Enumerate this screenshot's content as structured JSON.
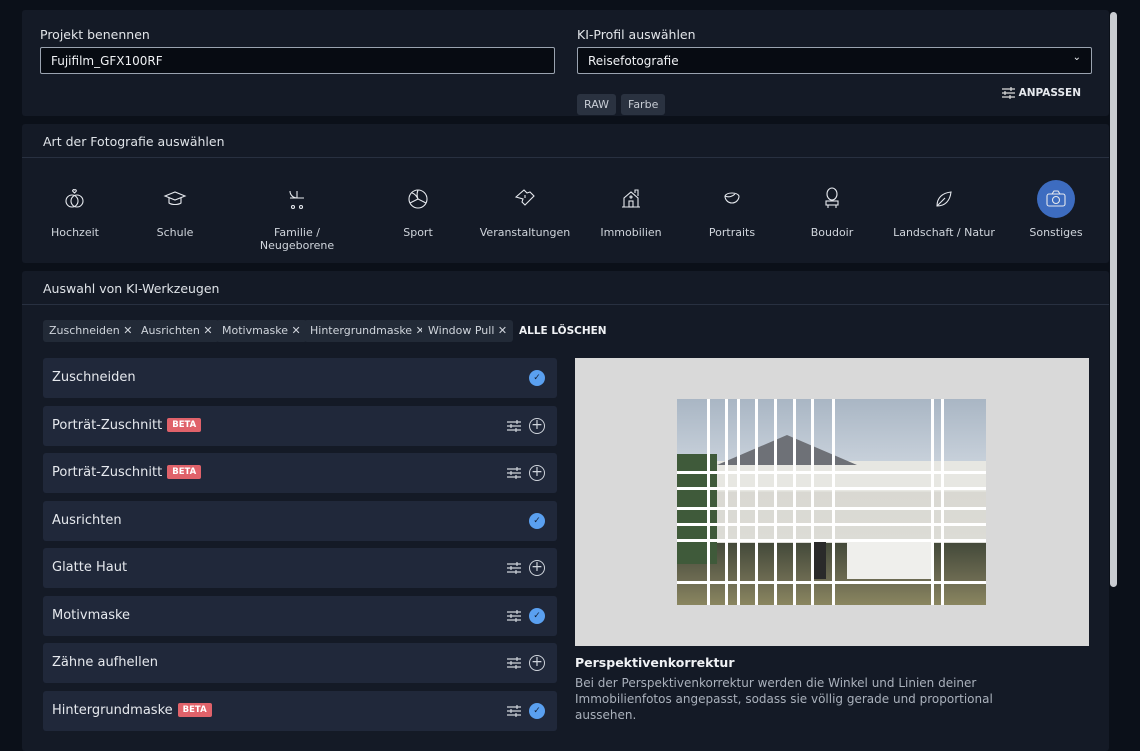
{
  "project": {
    "label": "Projekt benennen",
    "value": "Fujifilm_GFX100RF"
  },
  "profile": {
    "label": "KI-Profil auswählen",
    "value": "Reisefotografie",
    "chips": [
      "RAW",
      "Farbe"
    ],
    "adjust": "ANPASSEN"
  },
  "photo_types": {
    "title": "Art der Fotografie auswählen",
    "items": [
      {
        "label": "Hochzeit",
        "icon": "rings-icon"
      },
      {
        "label": "Schule",
        "icon": "graduation-cap-icon"
      },
      {
        "label": "Familie / Neugeborene",
        "icon": "stroller-icon"
      },
      {
        "label": "Sport",
        "icon": "volleyball-icon"
      },
      {
        "label": "Veranstaltungen",
        "icon": "ticket-icon"
      },
      {
        "label": "Immobilien",
        "icon": "house-icon"
      },
      {
        "label": "Portraits",
        "icon": "face-icon"
      },
      {
        "label": "Boudoir",
        "icon": "mirror-icon"
      },
      {
        "label": "Landschaft / Natur",
        "icon": "leaf-icon"
      },
      {
        "label": "Sonstiges",
        "icon": "camera-icon"
      }
    ],
    "selected": "Sonstiges"
  },
  "tools": {
    "title": "Auswahl von KI-Werkzeugen",
    "tags": [
      "Zuschneiden",
      "Ausrichten",
      "Motivmaske",
      "Hintergrundmaske",
      "Window Pull"
    ],
    "clear_all": "ALLE LÖSCHEN",
    "beta_label": "BETA",
    "items": [
      {
        "label": "Zuschneiden",
        "beta": false,
        "settings": false,
        "selected": true
      },
      {
        "label": "Porträt-Zuschnitt",
        "beta": true,
        "settings": true,
        "selected": false
      },
      {
        "label": "Porträt-Zuschnitt",
        "beta": true,
        "settings": true,
        "selected": false
      },
      {
        "label": "Ausrichten",
        "beta": false,
        "settings": false,
        "selected": true
      },
      {
        "label": "Glatte Haut",
        "beta": false,
        "settings": true,
        "selected": false
      },
      {
        "label": "Motivmaske",
        "beta": false,
        "settings": true,
        "selected": true
      },
      {
        "label": "Zähne aufhellen",
        "beta": false,
        "settings": true,
        "selected": false
      },
      {
        "label": "Hintergrundmaske",
        "beta": true,
        "settings": true,
        "selected": true
      }
    ]
  },
  "preview": {
    "title": "Perspektivenkorrektur",
    "description": "Bei der Perspektivenkorrektur werden die Winkel und Linien deiner Immobilienfotos angepasst, sodass sie völlig gerade und proportional aussehen."
  }
}
